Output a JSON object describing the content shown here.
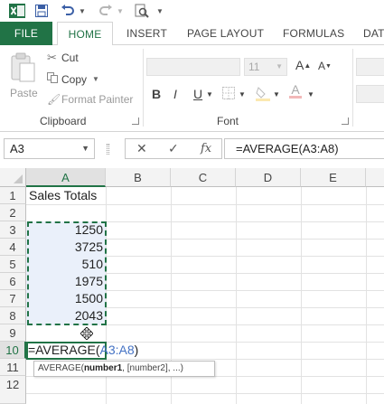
{
  "quick_access": {
    "icons": [
      "excel-logo",
      "save",
      "undo",
      "redo",
      "print-preview"
    ]
  },
  "tabs": [
    "FILE",
    "HOME",
    "INSERT",
    "PAGE LAYOUT",
    "FORMULAS",
    "DAT"
  ],
  "ribbon": {
    "clipboard": {
      "paste": "Paste",
      "cut": "Cut",
      "copy": "Copy",
      "format_painter": "Format Painter",
      "label": "Clipboard"
    },
    "font": {
      "size": "11",
      "bold": "B",
      "italic": "I",
      "underline": "U",
      "grow": "A",
      "shrink": "A",
      "font_color": "A",
      "label": "Font"
    }
  },
  "formula_bar": {
    "name_box": "A3",
    "cancel": "✕",
    "enter": "✓",
    "fx": "fx",
    "formula": "=AVERAGE(A3:A8)"
  },
  "sheet": {
    "columns": [
      "A",
      "B",
      "C",
      "D",
      "E"
    ],
    "rows": [
      "1",
      "2",
      "3",
      "4",
      "5",
      "6",
      "7",
      "8",
      "9",
      "10",
      "11",
      "12"
    ],
    "cells": {
      "a1": "Sales Totals",
      "a3": "1250",
      "a4": "3725",
      "a5": "510",
      "a6": "1975",
      "a7": "1500",
      "a8": "2043",
      "a10_prefix": "=AVERAGE(",
      "a10_ref": "A3:A8",
      "a10_suffix": ")"
    },
    "tooltip": {
      "func": "AVERAGE(",
      "arg1": "number1",
      "rest": ", [number2], ...)"
    }
  },
  "colors": {
    "accent": "#217346",
    "ref_blue": "#4472c4"
  }
}
